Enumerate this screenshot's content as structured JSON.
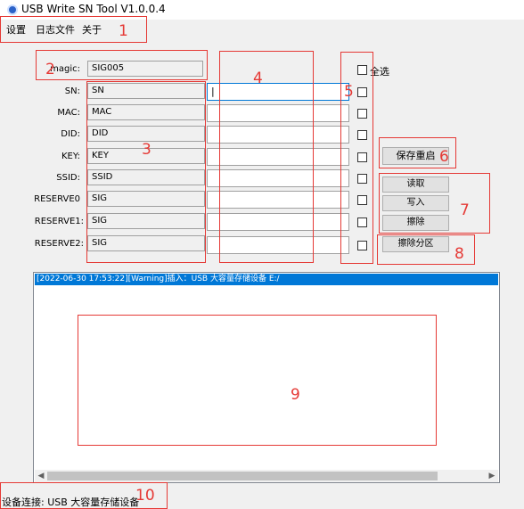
{
  "window": {
    "title": "USB Write SN Tool V1.0.0.4"
  },
  "menu": {
    "items": [
      "设置",
      "日志文件",
      "关于"
    ]
  },
  "magic": {
    "label": "magic:",
    "value": "SIG005"
  },
  "fields": [
    {
      "label": "SN:",
      "value": "SN",
      "input": "|"
    },
    {
      "label": "MAC:",
      "value": "MAC",
      "input": ""
    },
    {
      "label": "DID:",
      "value": "DID",
      "input": ""
    },
    {
      "label": "KEY:",
      "value": "KEY",
      "input": ""
    },
    {
      "label": "SSID:",
      "value": "SSID",
      "input": ""
    },
    {
      "label": "RESERVE0",
      "value": "SIG",
      "input": ""
    },
    {
      "label": "RESERVE1:",
      "value": "SIG",
      "input": ""
    },
    {
      "label": "RESERVE2:",
      "value": "SIG",
      "input": ""
    }
  ],
  "select_all": {
    "label": "全选",
    "checked": false
  },
  "buttons": {
    "save_restart": "保存重启",
    "read": "读取",
    "write": "写入",
    "erase": "擦除",
    "erase_partition": "擦除分区"
  },
  "log": {
    "lines": [
      "[2022-06-30 17:53:22][Warning]插入：USB 大容量存储设备 E:/"
    ]
  },
  "status_bar": {
    "text": "设备连接: USB 大容量存储设备"
  },
  "annotations": [
    "1",
    "2",
    "3",
    "4",
    "5",
    "6",
    "7",
    "8",
    "9",
    "10"
  ],
  "colors": {
    "annotation": "#e53935",
    "selection": "#0078d7"
  }
}
